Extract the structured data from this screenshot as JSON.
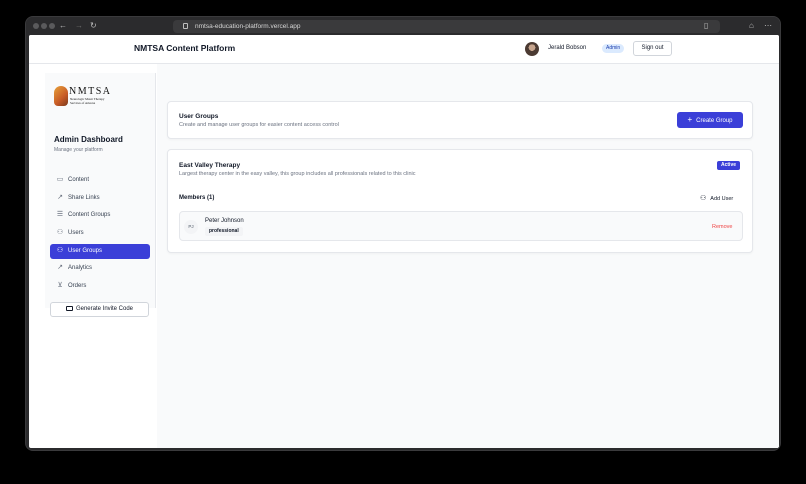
{
  "browser": {
    "url": "nmtsa-education-platform.vercel.app"
  },
  "header": {
    "brand": "NMTSA Content Platform",
    "user_name": "Jerald Bobson",
    "role_badge": "Admin",
    "sign_out": "Sign out"
  },
  "sidebar": {
    "logo_word": "NMTSA",
    "logo_sub": "Neurologic Music Therapy Services of Arizona",
    "title": "Admin Dashboard",
    "subtitle": "Manage your platform",
    "items": [
      {
        "label": "Content",
        "icon": "folder-icon"
      },
      {
        "label": "Share Links",
        "icon": "external-link-icon"
      },
      {
        "label": "Content Groups",
        "icon": "list-icon"
      },
      {
        "label": "Users",
        "icon": "users-icon"
      },
      {
        "label": "User Groups",
        "icon": "user-group-icon",
        "active": true
      },
      {
        "label": "Analytics",
        "icon": "trend-icon"
      },
      {
        "label": "Orders",
        "icon": "cart-icon"
      }
    ],
    "invite_button": "Generate Invite Code"
  },
  "main": {
    "header_card": {
      "title": "User Groups",
      "description": "Create and manage user groups for easier content access control",
      "create_button": "Create Group"
    },
    "group": {
      "name": "East Valley Therapy",
      "description": "Largest therapy center in the easy valley, this group includes all professionals related to this clinic",
      "status": "Active",
      "members_label": "Members (1)",
      "add_user": "Add User",
      "members": [
        {
          "initials": "PJ",
          "name": "Peter Johnson",
          "role": "professional",
          "remove": "Remove"
        }
      ]
    }
  },
  "colors": {
    "accent": "#3b3fd8",
    "danger": "#ef4444"
  }
}
